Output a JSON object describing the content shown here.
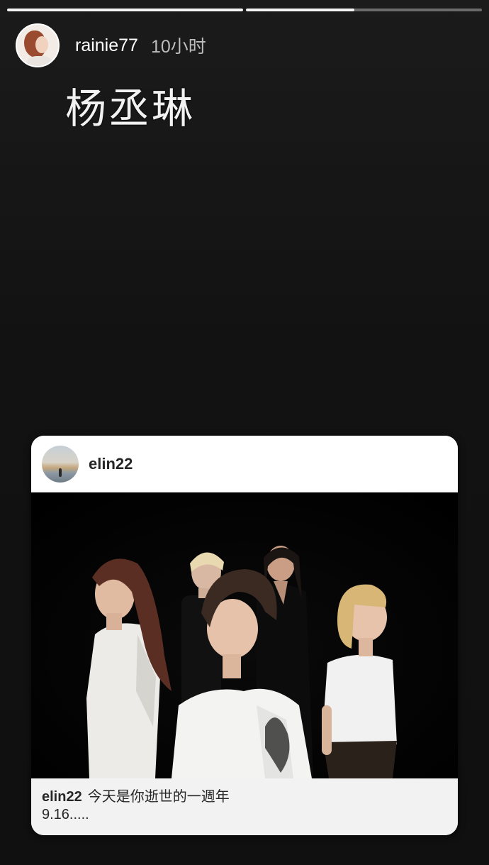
{
  "story": {
    "username": "rainie77",
    "time": "10小时",
    "text": "杨丞琳",
    "progress": [
      1.0,
      0.46
    ]
  },
  "shared_post": {
    "username": "elin22",
    "caption_user": "elin22",
    "caption_line1": "今天是你逝世的一週年",
    "caption_line2": "9.16....."
  }
}
